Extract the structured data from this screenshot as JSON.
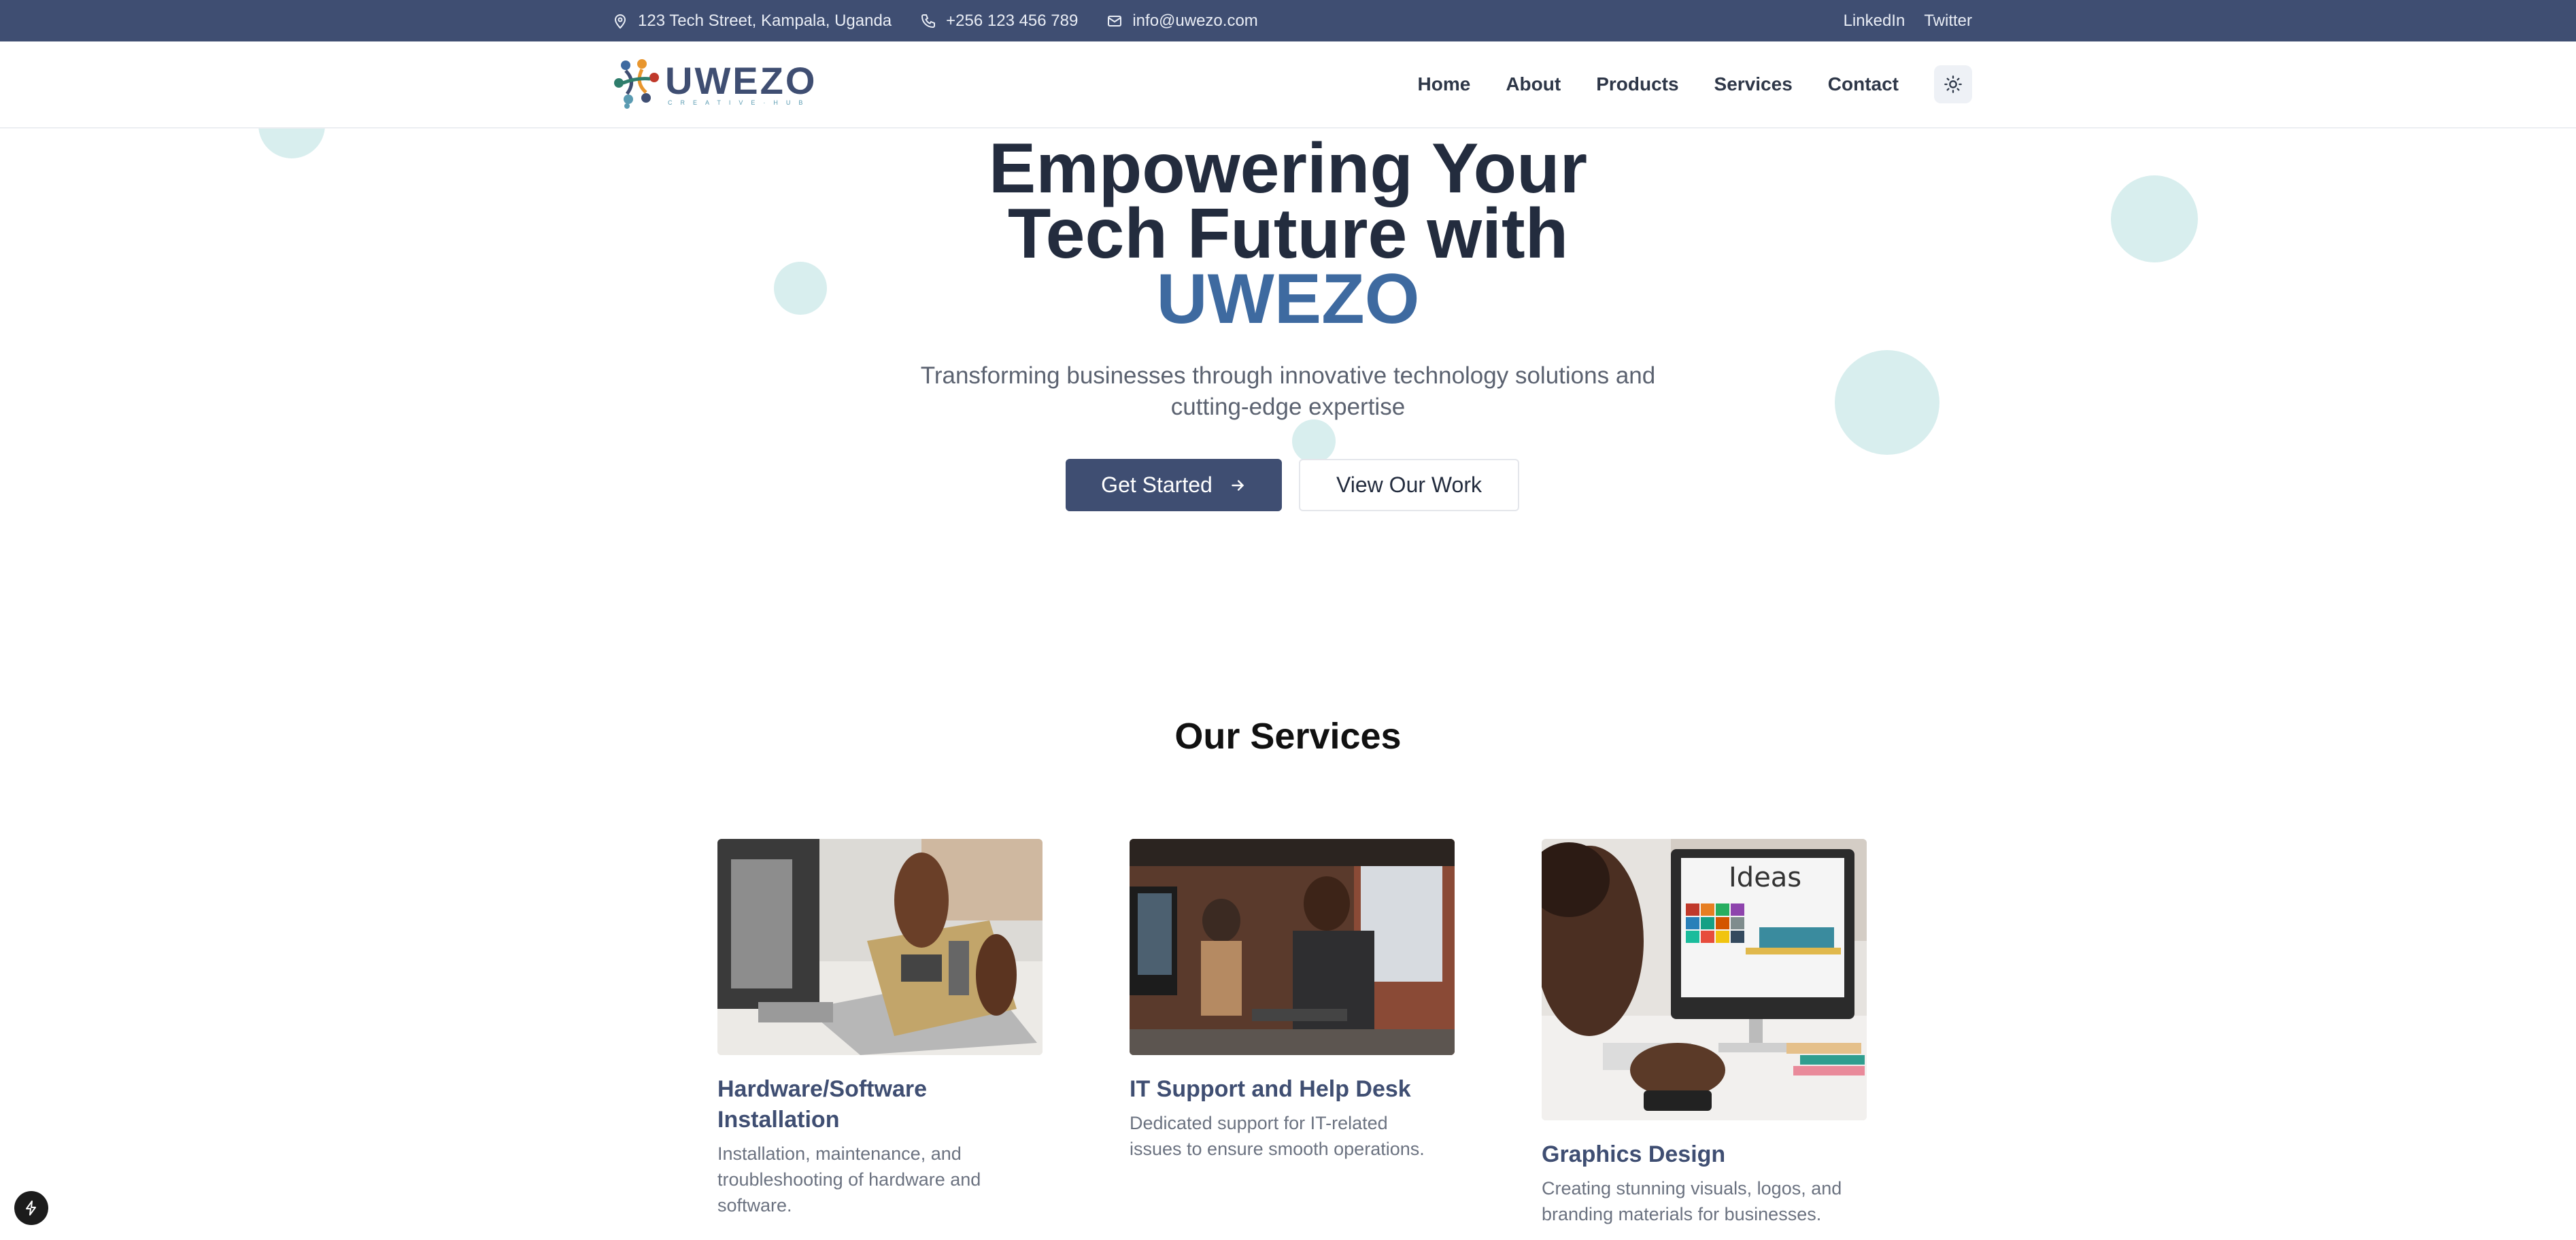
{
  "topbar": {
    "address": "123 Tech Street, Kampala, Uganda",
    "phone": "+256 123 456 789",
    "email": "info@uwezo.com",
    "links": [
      "LinkedIn",
      "Twitter"
    ]
  },
  "brand": {
    "name": "UWEZO",
    "tagline": "CREATIVE·HUB"
  },
  "nav": {
    "items": [
      "Home",
      "About",
      "Products",
      "Services",
      "Contact"
    ],
    "theme_toggle_icon": "sun-icon"
  },
  "hero": {
    "title_line1": "Empowering Your",
    "title_line2": "Tech Future with",
    "title_accent": "UWEZO",
    "subtitle_line1": "Transforming businesses through innovative technology solutions and",
    "subtitle_line2": "cutting-edge expertise",
    "primary_button": "Get Started",
    "secondary_button": "View Our Work"
  },
  "services": {
    "title": "Our Services",
    "cards": [
      {
        "title_line1": "Hardware/Software",
        "title_line2": "Installation",
        "desc_line1": "Installation, maintenance, and",
        "desc_line2": "troubleshooting of hardware and",
        "desc_line3": "software.",
        "image": "hardware-repair-photo"
      },
      {
        "title_line1": "IT Support and Help Desk",
        "desc_line1": "Dedicated support for IT-related",
        "desc_line2": "issues to ensure smooth operations.",
        "image": "help-desk-photo"
      },
      {
        "title_line1": "Graphics Design",
        "desc_line1": "Creating stunning visuals, logos, and",
        "desc_line2": "branding materials for businesses.",
        "image": "graphic-design-photo",
        "screen_text": "Ideas"
      }
    ]
  },
  "colors": {
    "primary": "#3f4e72",
    "accent": "#3e6aa0",
    "circle": "#d8eeee"
  }
}
